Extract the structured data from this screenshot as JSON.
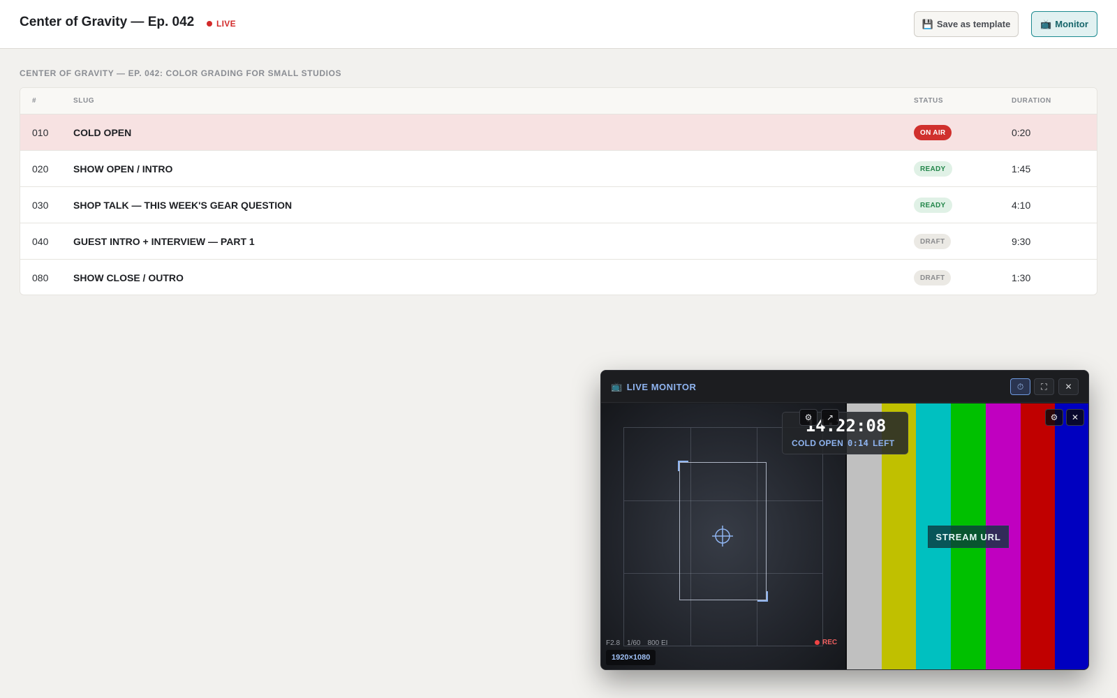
{
  "header": {
    "title": "Center of Gravity — Ep. 042",
    "live_label": "LIVE",
    "save_template_icon": "floppy-disk-icon",
    "save_template_label": "Save as template",
    "monitor_icon": "tv-icon",
    "monitor_label": "Monitor"
  },
  "rundown": {
    "title": "CENTER OF GRAVITY — EP. 042: COLOR GRADING FOR SMALL STUDIOS",
    "columns": {
      "num": "#",
      "slug": "SLUG",
      "status": "STATUS",
      "duration": "DURATION"
    },
    "rows": [
      {
        "num": "010",
        "slug": "COLD OPEN",
        "status": "ON AIR",
        "duration": "0:20"
      },
      {
        "num": "020",
        "slug": "SHOW OPEN / INTRO",
        "status": "READY",
        "duration": "1:45"
      },
      {
        "num": "030",
        "slug": "SHOP TALK — THIS WEEK'S GEAR QUESTION",
        "status": "READY",
        "duration": "4:10"
      },
      {
        "num": "040",
        "slug": "GUEST INTRO + INTERVIEW — PART 1",
        "status": "DRAFT",
        "duration": "9:30"
      },
      {
        "num": "080",
        "slug": "SHOW CLOSE / OUTRO",
        "status": "DRAFT",
        "duration": "1:30"
      }
    ],
    "status_colors": {
      "ON AIR": "#d0302d",
      "READY": "#23864a",
      "DRAFT": "#8a8b8d"
    }
  },
  "monitor": {
    "title": "LIVE MONITOR",
    "title_icon": "tv-icon",
    "buttons": {
      "timer": "⏱",
      "fullscreen": "⛶",
      "close": "✕"
    },
    "camera": {
      "aperture": "F2.8",
      "shutter": "1/60",
      "iso": "800 EI",
      "rec_label": "REC",
      "resolution": "1920×1080"
    },
    "clock": {
      "time": "14:22:08",
      "segment": "COLD OPEN",
      "remaining": "0:14",
      "remaining_suffix": "LEFT",
      "settings_icon": "⚙",
      "popout_icon": "↗"
    },
    "stream": {
      "label": "STREAM URL",
      "settings_icon": "⚙",
      "close_icon": "✕",
      "bar_colors": [
        "#c0c0c0",
        "#c0c000",
        "#00c0c0",
        "#00c000",
        "#c000c0",
        "#c00000",
        "#0000c0"
      ]
    }
  }
}
